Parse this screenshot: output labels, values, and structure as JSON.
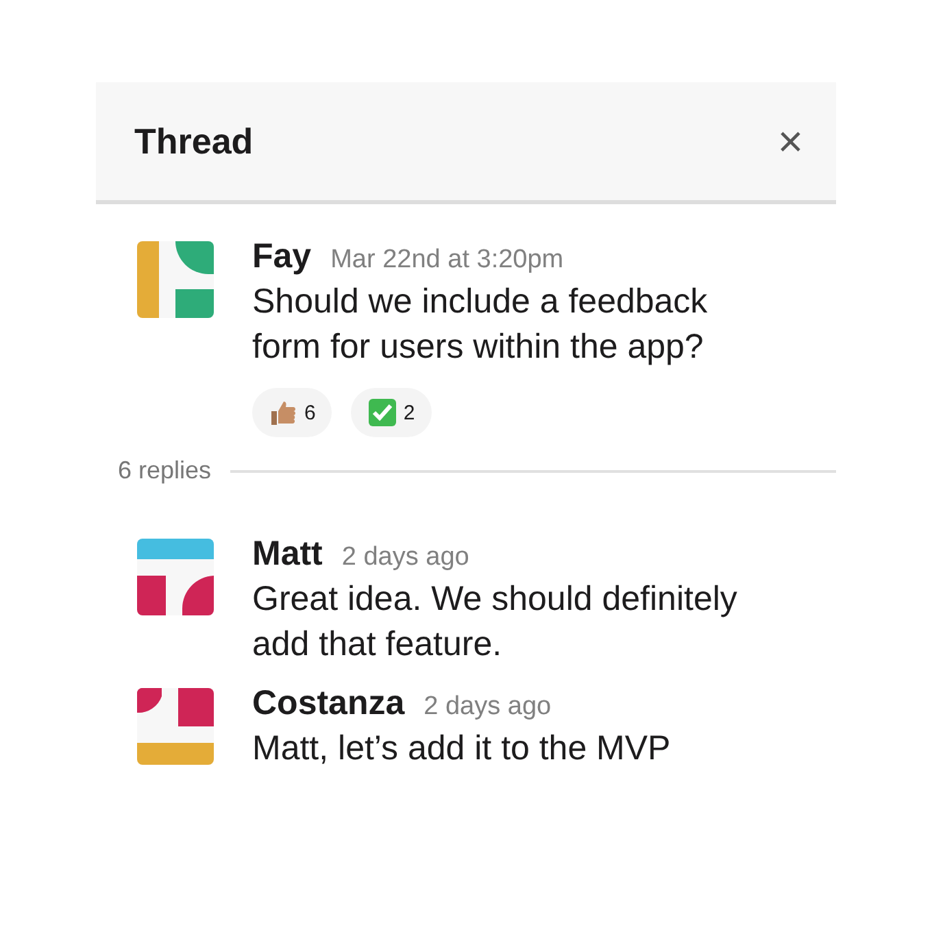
{
  "thread": {
    "title": "Thread",
    "close": "×"
  },
  "parent": {
    "avatar": {
      "kind": "a"
    },
    "name": "Fay",
    "time": "Mar 22nd at 3:20pm",
    "text": "Should we include a feedback form for users within the app?",
    "reactions": [
      {
        "kind": "thumbs-up",
        "count": "6"
      },
      {
        "kind": "check",
        "count": "2"
      }
    ]
  },
  "reply_count": "6 replies",
  "replies": [
    {
      "avatar": {
        "kind": "b"
      },
      "name": "Matt",
      "time": "2 days ago",
      "text": "Great idea. We should definitely add that feature."
    },
    {
      "avatar": {
        "kind": "c"
      },
      "name": "Costanza",
      "time": "2 days ago",
      "text": "Matt, let’s add it to the MVP"
    }
  ]
}
